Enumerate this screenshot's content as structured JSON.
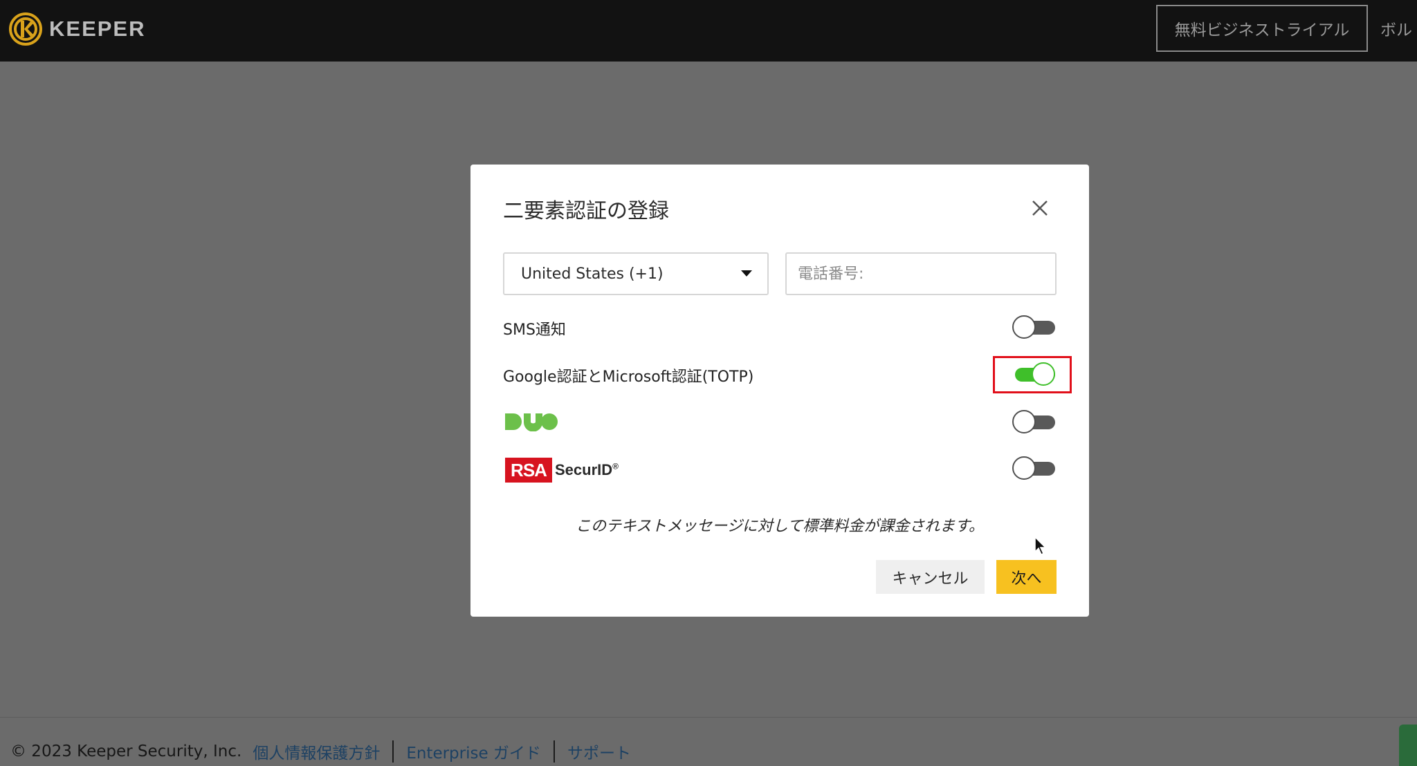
{
  "header": {
    "brand": "KEEPER",
    "trial_button": "無料ビジネストライアル",
    "vault_link": "ボル"
  },
  "dialog": {
    "title": "二要素認証の登録",
    "country_select": {
      "value": "United States (+1)"
    },
    "phone": {
      "placeholder": "電話番号:",
      "value": ""
    },
    "options": {
      "sms": {
        "label": "SMS通知",
        "enabled": false
      },
      "totp": {
        "label": "Google認証とMicrosoft認証(TOTP)",
        "enabled": true
      },
      "duo": {
        "logo_text": "DUO",
        "enabled": false
      },
      "rsa": {
        "logo_text": "RSA",
        "product": "SecurID",
        "mark": "®",
        "enabled": false
      }
    },
    "notice": "このテキストメッセージに対して標準料金が課金されます。",
    "cancel_label": "キャンセル",
    "next_label": "次へ"
  },
  "footer": {
    "copyright": "© 2023 Keeper Security, Inc.",
    "privacy_link": "個人情報保護方針",
    "enterprise_link": "Enterprise ガイド",
    "support_link": "サポート"
  },
  "colors": {
    "topbar": "#121212",
    "overlay": "#6b6b6b",
    "toggle_on": "#3fbf2a",
    "highlight": "#e10f1a",
    "next_button": "#f7c120",
    "logo_gold": "#d9a21b"
  }
}
